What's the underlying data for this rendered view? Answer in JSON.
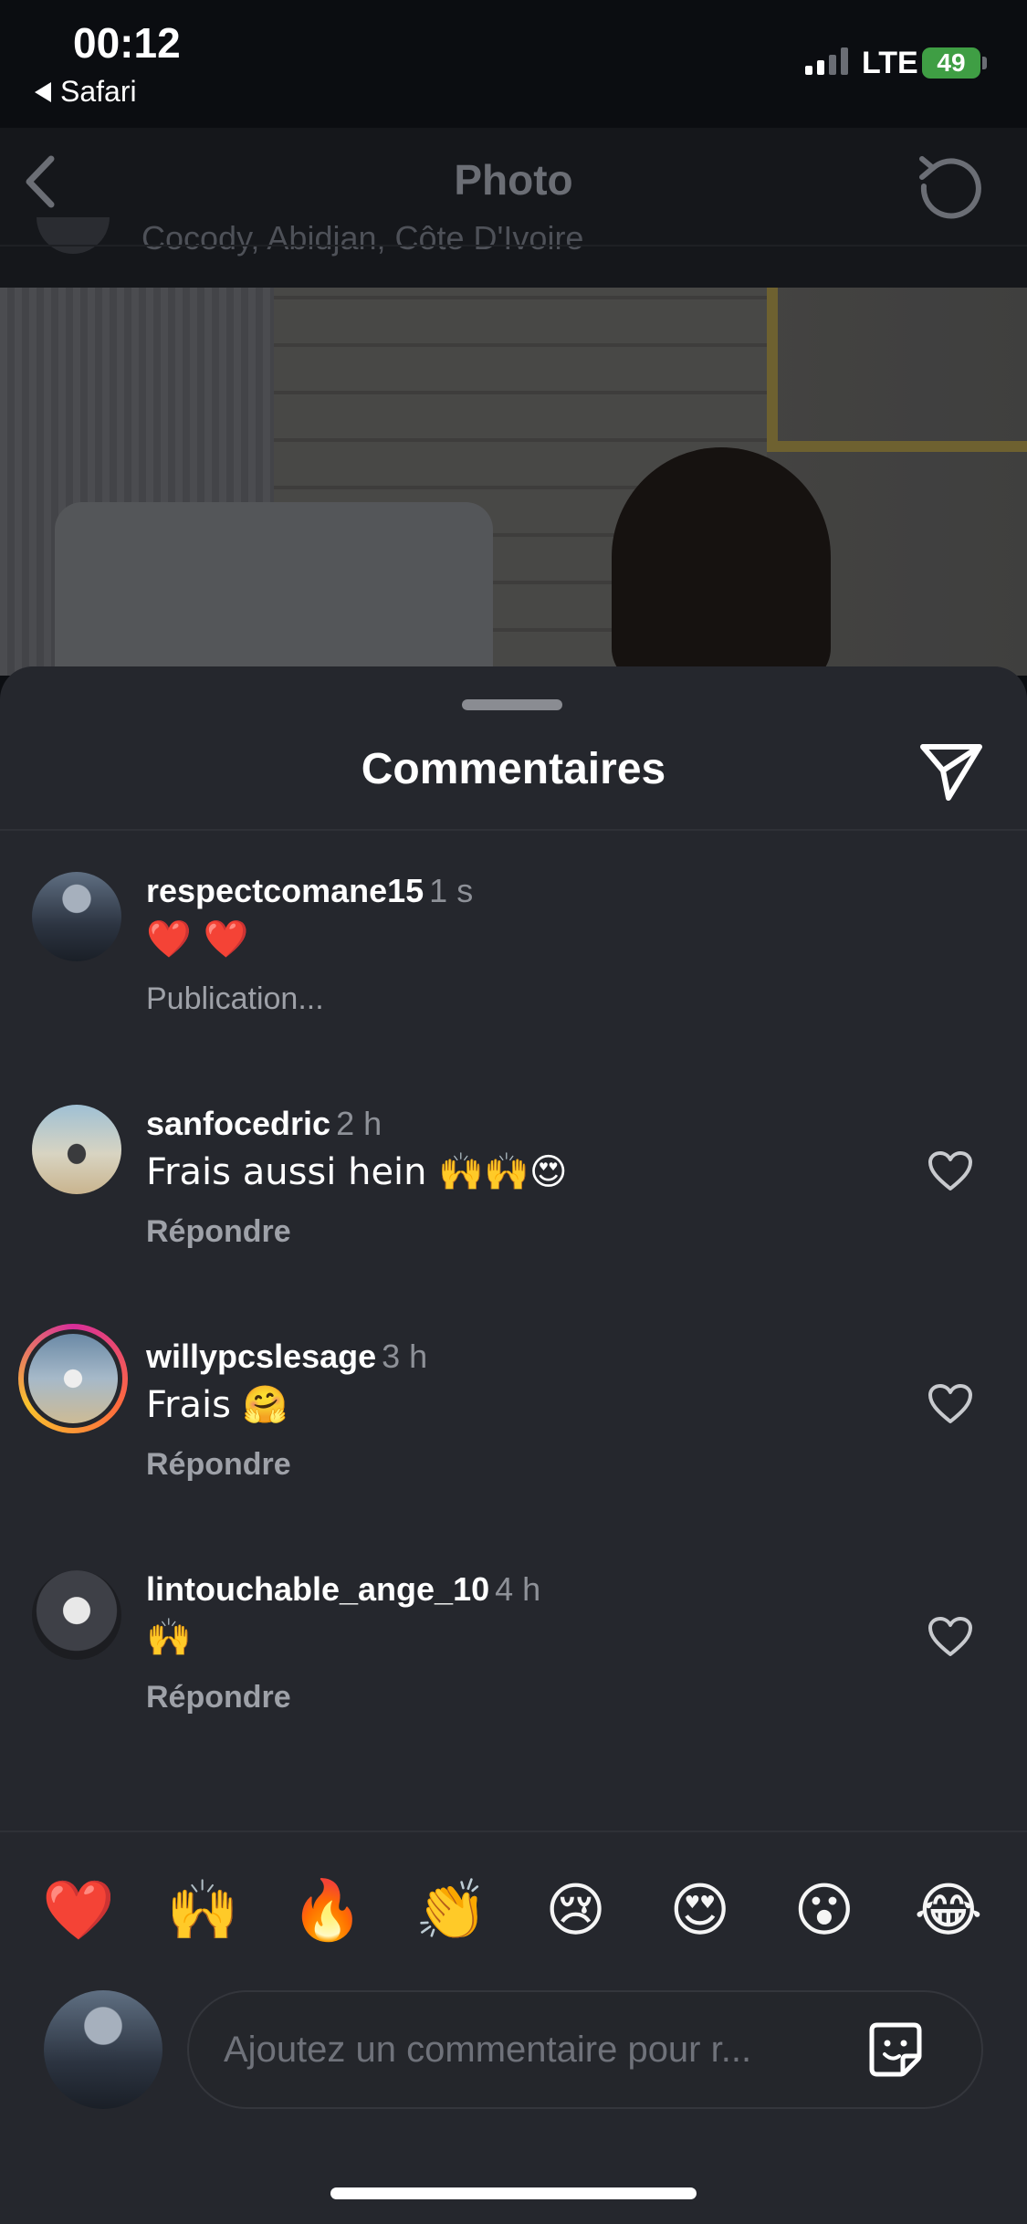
{
  "status_bar": {
    "time": "00:12",
    "back_app": "Safari",
    "network": "LTE",
    "battery": "49"
  },
  "nav": {
    "title": "Photo",
    "location": "Cocody, Abidjan, Côte D'Ivoire"
  },
  "sheet": {
    "title": "Commentaires"
  },
  "comments": [
    {
      "username": "respectcomane15",
      "time": "1 s",
      "text": "❤️ ❤️",
      "status": "Publication...",
      "avatar": "suit"
    },
    {
      "username": "sanfocedric",
      "time": "2 h",
      "text": "Frais aussi hein 🙌🙌😍",
      "reply": "Répondre",
      "avatar": "beach"
    },
    {
      "username": "willypcslesage",
      "time": "3 h",
      "text": "Frais 🤗",
      "reply": "Répondre",
      "avatar": "beach-story"
    },
    {
      "username": "lintouchable_ange_10",
      "time": "4 h",
      "text": "🙌",
      "reply": "Répondre",
      "avatar": "dark"
    }
  ],
  "emoji_bar": [
    "❤️",
    "🙌",
    "🔥",
    "👏",
    "😢",
    "😍",
    "😮",
    "😂"
  ],
  "composer": {
    "placeholder": "Ajoutez un commentaire pour r..."
  },
  "icons": {
    "back": "chevron-left-icon",
    "refresh": "refresh-icon",
    "share": "paper-plane-icon",
    "like": "heart-icon",
    "sticker": "sticker-icon"
  }
}
